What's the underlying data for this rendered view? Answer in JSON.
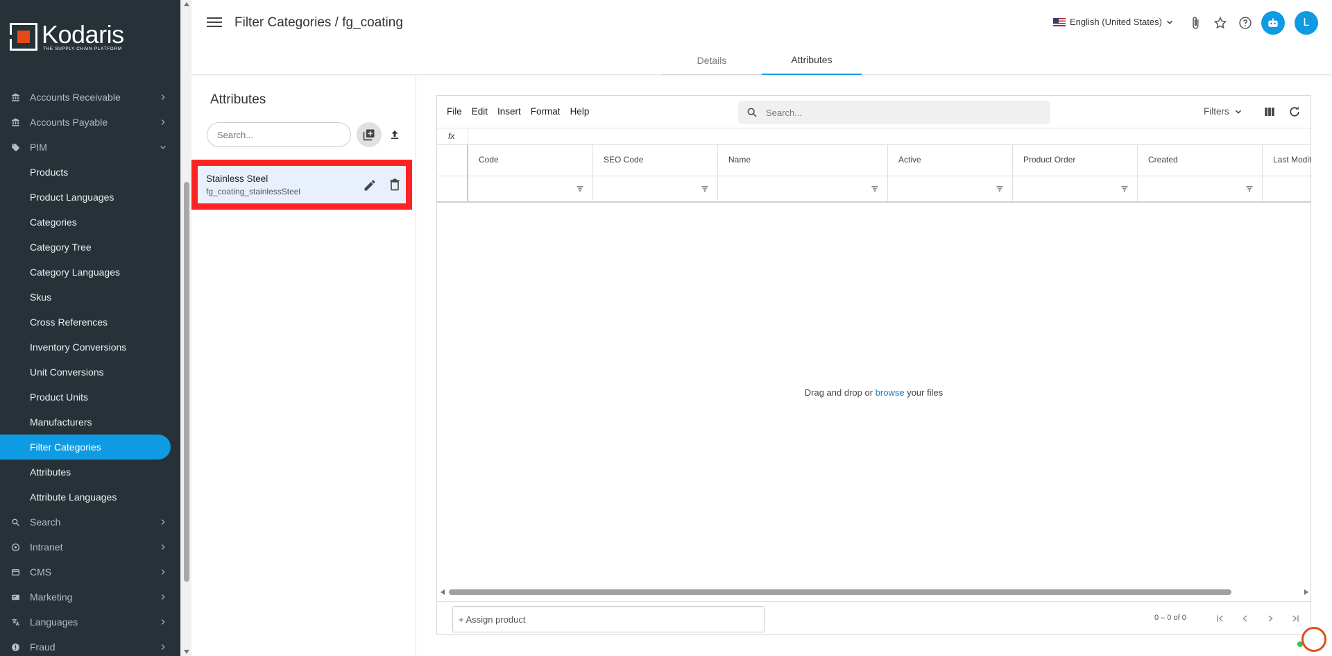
{
  "brand": {
    "name": "Kodaris",
    "tagline": "THE SUPPLY CHAIN PLATFORM"
  },
  "sidebar": {
    "groups": [
      {
        "label": "Accounts Receivable",
        "icon": "bank-icon",
        "expanded": false
      },
      {
        "label": "Accounts Payable",
        "icon": "bank-icon",
        "expanded": false
      },
      {
        "label": "PIM",
        "icon": "tag-icon",
        "expanded": true
      }
    ],
    "pim_items": [
      {
        "label": "Products"
      },
      {
        "label": "Product Languages"
      },
      {
        "label": "Categories"
      },
      {
        "label": "Category Tree"
      },
      {
        "label": "Category Languages"
      },
      {
        "label": "Skus"
      },
      {
        "label": "Cross References"
      },
      {
        "label": "Inventory Conversions"
      },
      {
        "label": "Unit Conversions"
      },
      {
        "label": "Product Units"
      },
      {
        "label": "Manufacturers"
      },
      {
        "label": "Filter Categories",
        "active": true
      },
      {
        "label": "Attributes"
      },
      {
        "label": "Attribute Languages"
      }
    ],
    "after_groups": [
      {
        "label": "Search",
        "icon": "search-icon"
      },
      {
        "label": "Intranet",
        "icon": "intranet-icon"
      },
      {
        "label": "CMS",
        "icon": "cms-icon"
      },
      {
        "label": "Marketing",
        "icon": "marketing-icon"
      },
      {
        "label": "Languages",
        "icon": "translate-icon"
      },
      {
        "label": "Fraud",
        "icon": "fraud-icon"
      }
    ]
  },
  "header": {
    "title": "Filter Categories / fg_coating",
    "language": "English (United States)",
    "avatar_initial": "L",
    "tabs": [
      {
        "label": "Details"
      },
      {
        "label": "Attributes",
        "active": true
      }
    ]
  },
  "list_panel": {
    "title": "Attributes",
    "search_placeholder": "Search...",
    "items": [
      {
        "title": "Stainless Steel",
        "code": "fg_coating_stainlessSteel"
      }
    ]
  },
  "grid": {
    "menu": [
      "File",
      "Edit",
      "Insert",
      "Format",
      "Help"
    ],
    "search_placeholder": "Search...",
    "filters_label": "Filters",
    "fx_label": "fx",
    "columns": [
      "Code",
      "SEO Code",
      "Name",
      "Active",
      "Product Order",
      "Created",
      "Last Modifi"
    ],
    "empty_prefix": "Drag and drop or ",
    "empty_link": "browse",
    "empty_suffix": " your files",
    "assign_label": "+ Assign product",
    "range_label": "0 – 0 of 0"
  },
  "colors": {
    "accent": "#0f9be3",
    "sidebar_bg": "#263238",
    "highlight": "#f22",
    "brand_orange": "#e64a19"
  }
}
